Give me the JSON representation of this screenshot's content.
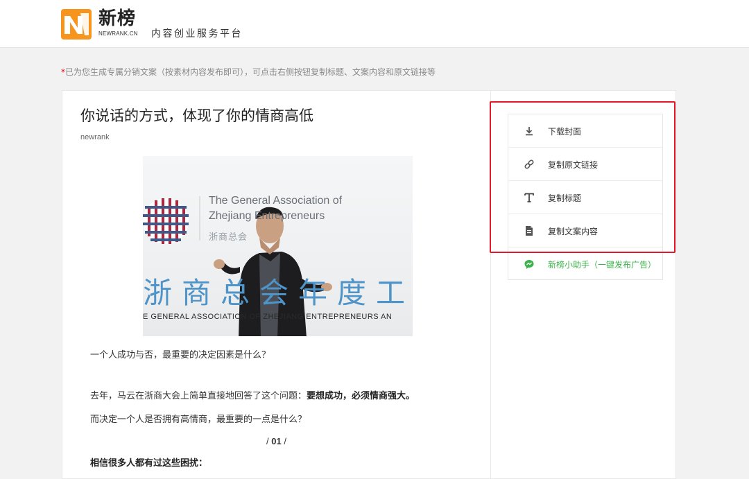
{
  "header": {
    "logo_name": "新榜",
    "logo_sub": "NEWRANK.CN",
    "tagline": "内容创业服务平台"
  },
  "notice": {
    "star": "*",
    "text": "已为您生成专属分销文案（按素材内容发布即可），可点击右侧按钮复制标题、文案内容和原文链接等"
  },
  "article": {
    "title": "你说话的方式，体现了你的情商高低",
    "author": "newrank",
    "photo": {
      "en_line1": "The General Association of",
      "en_line2": "Zhejiang Entrepreneurs",
      "cn_small": "浙商总会",
      "cn_big": "浙商总会年度工",
      "en_bottom": "E GENERAL ASSOCIATION OF ZHEJIANG ENTREPRENEURS AN"
    },
    "p1": "一个人成功与否，最重要的决定因素是什么？",
    "p2_normal": "去年，马云在浙商大会上简单直接地回答了这个问题：",
    "p2_bold": "要想成功，必须情商强大。",
    "p3": "而决定一个人是否拥有高情商，最重要的一点是什么？",
    "section_pre": "/ ",
    "section_num": "01",
    "section_post": " /",
    "p4": "相信很多人都有过这些困扰："
  },
  "actions": [
    {
      "label": "下载封面",
      "icon": "download-icon"
    },
    {
      "label": "复制原文链接",
      "icon": "link-icon"
    },
    {
      "label": "复制标题",
      "icon": "title-t-icon"
    },
    {
      "label": "复制文案内容",
      "icon": "document-icon"
    },
    {
      "label": "新榜小助手（一键发布广告）",
      "icon": "chat-bubble-icon"
    }
  ],
  "colors": {
    "logo_orange": "#f7941d",
    "highlight_red": "#e2182a",
    "assistant_green": "#3cb34a",
    "notice_star_red": "#e60012"
  }
}
